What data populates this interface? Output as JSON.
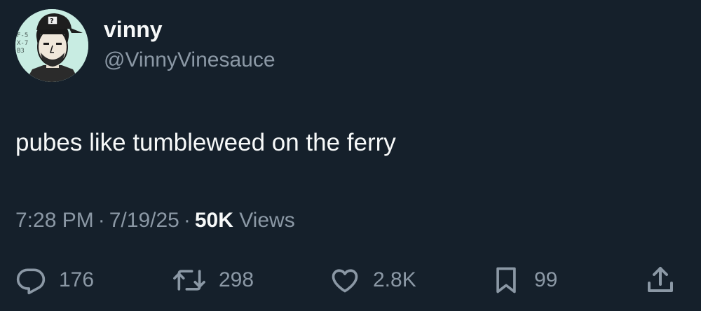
{
  "author": {
    "display_name": "vinny",
    "handle": "@VinnyVinesauce",
    "avatar_bg": "#c8ece2"
  },
  "tweet": {
    "text": "pubes like tumbleweed on the ferry"
  },
  "meta": {
    "time": "7:28 PM",
    "separator": "·",
    "date": "7/19/25",
    "views_count": "50K",
    "views_label": "Views"
  },
  "actions": {
    "replies": "176",
    "reposts": "298",
    "likes": "2.8K",
    "bookmarks": "99"
  },
  "icons": {
    "reply": "reply-icon",
    "repost": "repost-icon",
    "like": "heart-icon",
    "bookmark": "bookmark-icon",
    "share": "share-icon"
  },
  "colors": {
    "background": "#15202b",
    "text": "#f7f9f9",
    "secondary": "#8b98a5"
  }
}
